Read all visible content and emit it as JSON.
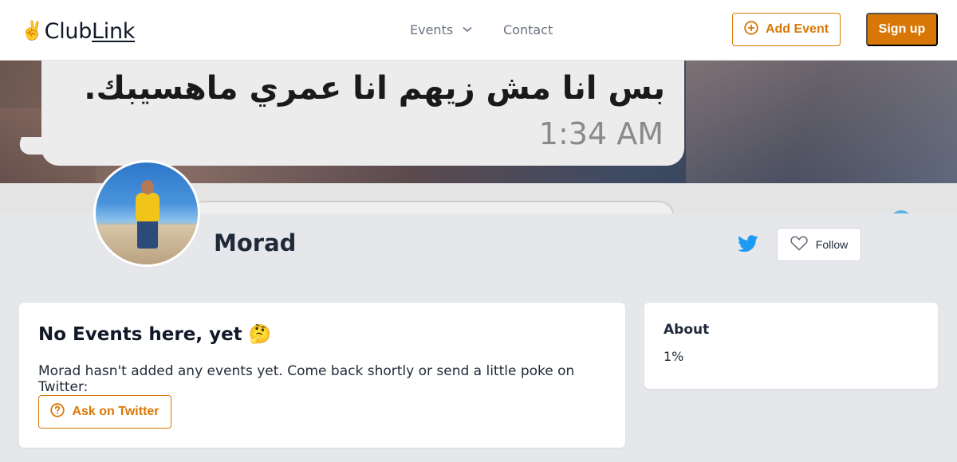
{
  "brand": {
    "hand_emoji": "✌️",
    "name_part1": "Club",
    "name_part2": "Link"
  },
  "nav": {
    "events_label": "Events",
    "contact_label": "Contact"
  },
  "header_actions": {
    "add_event_label": "Add Event",
    "signup_label": "Sign up"
  },
  "cover": {
    "message_text": "بس انا مش زيهم انا عمري ماهسيبك.",
    "message_time": "1:34 AM"
  },
  "profile": {
    "name": "Morad",
    "follow_label": "Follow"
  },
  "events_card": {
    "title": "No Events here, yet 🤔",
    "description": "Morad hasn't added any events yet. Come back shortly or send a little poke on Twitter:",
    "ask_label": "Ask on Twitter"
  },
  "about_card": {
    "title": "About",
    "text": "1%"
  },
  "colors": {
    "accent": "#d97706",
    "twitter": "#1d9bf0",
    "page_bg": "#e5e7eb"
  },
  "icons": [
    "victory-hand-icon",
    "chevron-down-icon",
    "plus-circle-icon",
    "twitter-icon",
    "heart-icon",
    "question-circle-icon"
  ]
}
